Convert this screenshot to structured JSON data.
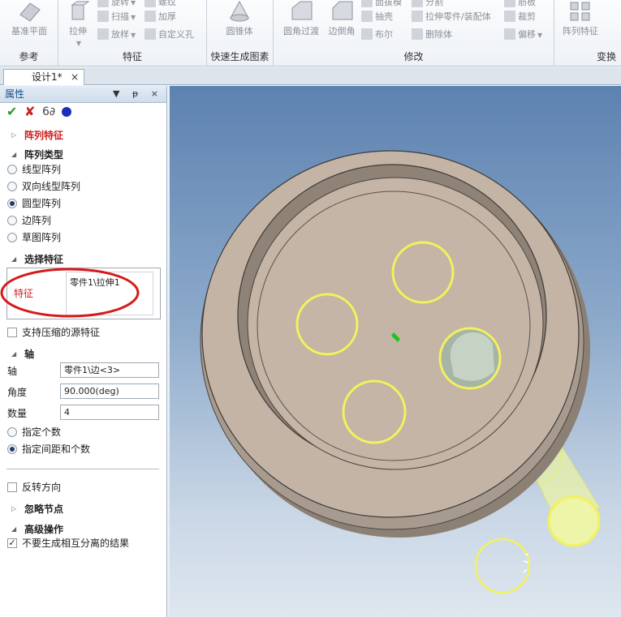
{
  "ribbon": {
    "groups": [
      {
        "label": "参考",
        "buttons": [
          {
            "label": "基准平面"
          }
        ]
      },
      {
        "label": "特征",
        "big": "拉伸",
        "small": [
          "旋转",
          "扫描",
          "放样",
          "螺纹",
          "加厚",
          "自定义孔"
        ]
      },
      {
        "label": "快速生成图素",
        "big": "圆锥体"
      },
      {
        "label": "修改",
        "big": [
          "圆角过渡",
          "边倒角"
        ],
        "small": [
          "面拔模",
          "抽壳",
          "布尔",
          "分割",
          "拉伸零件/装配体",
          "删除体",
          "筋板",
          "裁剪",
          "偏移"
        ]
      },
      {
        "label": "变换",
        "big": "阵列特征"
      }
    ]
  },
  "tab": {
    "title": "设计1*",
    "close": "×"
  },
  "panel": {
    "title": "属性",
    "title_buttons": "▼ ᵽ ×",
    "section_feature_pattern": "阵列特征",
    "section_pattern_type": "阵列类型",
    "pattern_types": [
      {
        "label": "线型阵列",
        "checked": false
      },
      {
        "label": "双向线型阵列",
        "checked": false
      },
      {
        "label": "圆型阵列",
        "checked": true
      },
      {
        "label": "边阵列",
        "checked": false
      },
      {
        "label": "草图阵列",
        "checked": false
      }
    ],
    "section_select": "选择特征",
    "feature_label": "特征",
    "feature_value": "零件1\\拉伸1",
    "support_suppressed": "支持压缩的源特征",
    "section_axis": "轴",
    "axis_label": "轴",
    "axis_value": "零件1\\边<3>",
    "angle_label": "角度",
    "angle_value": "90.000(deg)",
    "count_label": "数量",
    "count_value": "4",
    "mode_count": "指定个数",
    "mode_spacing": "指定间距和个数",
    "reverse": "反转方向",
    "section_ignore": "忽略节点",
    "section_advanced": "高级操作",
    "no_separate": "不要生成相互分离的结果",
    "no_separate_checked": true
  },
  "colors": {
    "highlight_red": "#cc1f1f",
    "accent_blue": "#1a4f8b",
    "part_face": "#c3b4a6",
    "selection_yellow": "#f2f25a"
  }
}
